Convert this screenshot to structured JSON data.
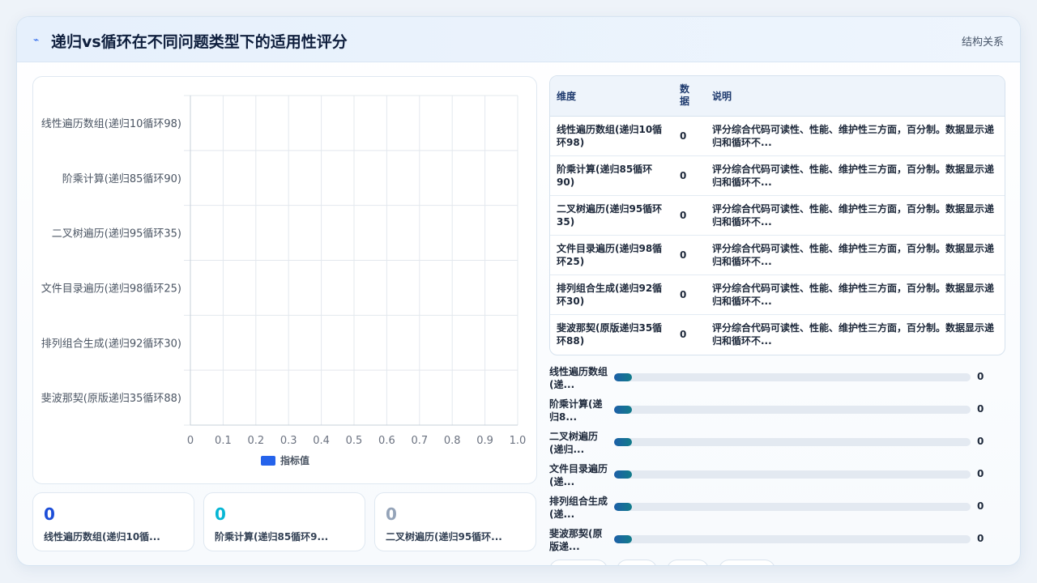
{
  "header": {
    "icon": "lightning-icon",
    "title": "递归vs循环在不同问题类型下的适用性评分",
    "tag": "结构关系"
  },
  "chart_data": {
    "type": "bar",
    "orientation": "horizontal",
    "categories": [
      "线性遍历数组(递归10循环98)",
      "阶乘计算(递归85循环90)",
      "二叉树遍历(递归95循环35)",
      "文件目录遍历(递归98循环25)",
      "排列组合生成(递归92循环30)",
      "斐波那契(原版递归35循环88)"
    ],
    "series": [
      {
        "name": "指标值",
        "values": [
          0,
          0,
          0,
          0,
          0,
          0
        ],
        "color": "#2563eb"
      }
    ],
    "xlim": [
      0,
      1.0
    ],
    "xticks": [
      "0",
      "0.1",
      "0.2",
      "0.3",
      "0.4",
      "0.5",
      "0.6",
      "0.7",
      "0.8",
      "0.9",
      "1.0"
    ],
    "grid": true,
    "legend_position": "bottom"
  },
  "kpis": [
    {
      "value": "0",
      "label": "线性遍历数组(递归10循...",
      "color": "#1d4ed8"
    },
    {
      "value": "0",
      "label": "阶乘计算(递归85循环9...",
      "color": "#06b6d4"
    },
    {
      "value": "0",
      "label": "二叉树遍历(递归95循环...",
      "color": "#94a3b8"
    }
  ],
  "table": {
    "headers": [
      "维度",
      "数据",
      "说明"
    ],
    "rows": [
      {
        "dim": "线性遍历数组(递归10循环98)",
        "value": "0",
        "desc": "评分综合代码可读性、性能、维护性三方面，百分制。数据显示递归和循环不..."
      },
      {
        "dim": "阶乘计算(递归85循环90)",
        "value": "0",
        "desc": "评分综合代码可读性、性能、维护性三方面，百分制。数据显示递归和循环不..."
      },
      {
        "dim": "二叉树遍历(递归95循环35)",
        "value": "0",
        "desc": "评分综合代码可读性、性能、维护性三方面，百分制。数据显示递归和循环不..."
      },
      {
        "dim": "文件目录遍历(递归98循环25)",
        "value": "0",
        "desc": "评分综合代码可读性、性能、维护性三方面，百分制。数据显示递归和循环不..."
      },
      {
        "dim": "排列组合生成(递归92循环30)",
        "value": "0",
        "desc": "评分综合代码可读性、性能、维护性三方面，百分制。数据显示递归和循环不..."
      },
      {
        "dim": "斐波那契(原版递归35循环88)",
        "value": "0",
        "desc": "评分综合代码可读性、性能、维护性三方面，百分制。数据显示递归和循环不..."
      }
    ]
  },
  "bars": [
    {
      "label": "线性遍历数组(递...",
      "value": "0"
    },
    {
      "label": "阶乘计算(递归8...",
      "value": "0"
    },
    {
      "label": "二叉树遍历(递归...",
      "value": "0"
    },
    {
      "label": "文件目录遍历(递...",
      "value": "0"
    },
    {
      "label": "排列组合生成(递...",
      "value": "0"
    },
    {
      "label": "斐波那契(原版递...",
      "value": "0"
    }
  ]
}
